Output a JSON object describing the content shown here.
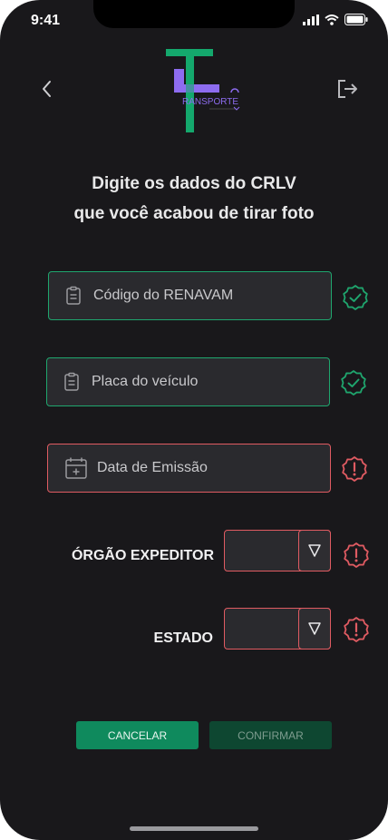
{
  "status": {
    "time": "9:41"
  },
  "logo": {
    "text": "RANSPORTE"
  },
  "heading": {
    "line1": "Digite os dados do CRLV",
    "line2": "que você acabou de tirar foto"
  },
  "fields": [
    {
      "label": "Código do RENAVAM",
      "state": "valid",
      "icon": "clipboard-icon"
    },
    {
      "label": "Placa do veículo",
      "state": "valid",
      "icon": "clipboard-icon"
    },
    {
      "label": "Data de Emissão",
      "state": "invalid",
      "icon": "calendar-icon"
    }
  ],
  "dropdowns": [
    {
      "label": "ÓRGÃO EXPEDITOR",
      "value": "",
      "state": "invalid"
    },
    {
      "label": "ESTADO",
      "value": "",
      "state": "invalid"
    }
  ],
  "buttons": {
    "cancel": "CANCELAR",
    "confirm": "CONFIRMAR"
  },
  "colors": {
    "valid": "#1fa66e",
    "invalid": "#e05b62",
    "primary": "#0f8a5d",
    "background": "#19181b"
  }
}
